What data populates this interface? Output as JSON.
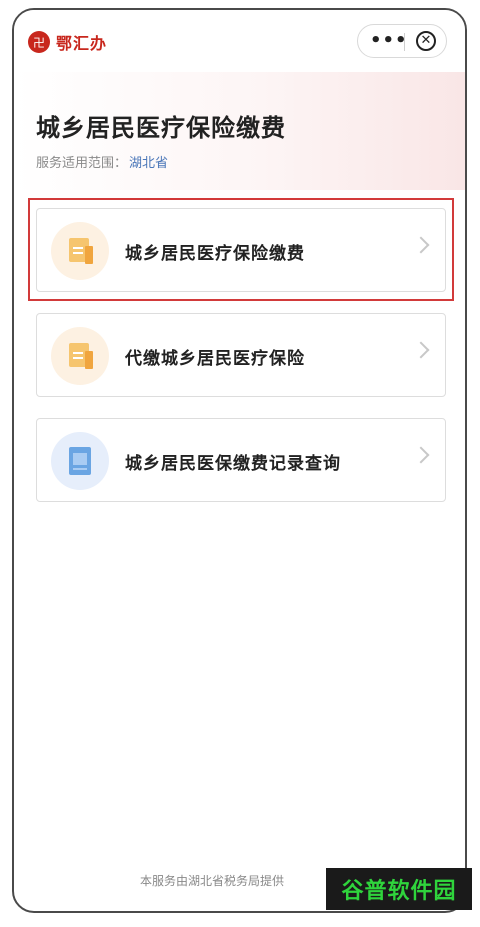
{
  "app": {
    "brand": "鄂汇办",
    "logo_glyph": "卍",
    "accent": "#c8271d"
  },
  "capsule": {
    "more": "•••",
    "close": "✕"
  },
  "hero": {
    "title": "城乡居民医疗保险缴费",
    "scope_label": "服务适用范围：",
    "scope_value": "湖北省"
  },
  "services": [
    {
      "label": "城乡居民医疗保险缴费",
      "icon": "document-icon",
      "highlighted": true
    },
    {
      "label": "代缴城乡居民医疗保险",
      "icon": "document-icon",
      "highlighted": false
    },
    {
      "label": "城乡居民医保缴费记录查询",
      "icon": "record-book-icon",
      "highlighted": false
    }
  ],
  "footer": {
    "text": "本服务由湖北省税务局提供"
  },
  "watermark": {
    "text": "谷普软件园"
  }
}
